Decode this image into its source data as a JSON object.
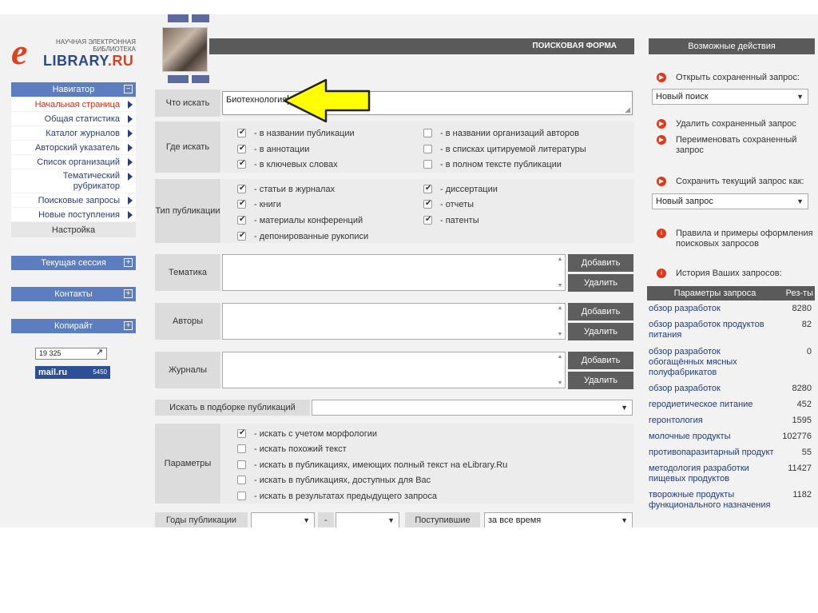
{
  "logo": {
    "line1": "НАУЧНАЯ ЭЛЕКТРОННАЯ",
    "line2": "БИБЛИОТЕКА",
    "letter": "e",
    "name_a": "LIBRARY",
    "name_b": ".RU"
  },
  "nav": {
    "header": "Навигатор",
    "items": [
      {
        "label": "Начальная страница",
        "active": true
      },
      {
        "label": "Общая статистика"
      },
      {
        "label": "Каталог журналов"
      },
      {
        "label": "Авторский указатель"
      },
      {
        "label": "Список организаций"
      },
      {
        "label": "Тематический рубрикатор"
      },
      {
        "label": "Поисковые запросы"
      },
      {
        "label": "Новые поступления"
      }
    ],
    "settings": "Настройка",
    "session": "Текущая сессия",
    "contacts": "Контакты",
    "copyright": "Копирайт"
  },
  "counters": {
    "liveinternet": "19 325",
    "mailru": "mail.ru",
    "mailru_num": "5450"
  },
  "form": {
    "title": "ПОИСКОВАЯ ФОРМА",
    "what_label": "Что искать",
    "query": "Биотехнология",
    "where_label": "Где искать",
    "where": [
      {
        "label": "- в названии публикации",
        "checked": true
      },
      {
        "label": "- в аннотации",
        "checked": true
      },
      {
        "label": "- в ключевых словах",
        "checked": true
      },
      {
        "label": "- в названии организаций авторов",
        "checked": false
      },
      {
        "label": "- в списках цитируемой литературы",
        "checked": false
      },
      {
        "label": "- в полном тексте публикации",
        "checked": false
      }
    ],
    "type_label": "Тип публикации",
    "types": [
      {
        "label": "- статьи в журналах",
        "checked": true
      },
      {
        "label": "- книги",
        "checked": true
      },
      {
        "label": "- материалы конференций",
        "checked": true
      },
      {
        "label": "- депонированные рукописи",
        "checked": true
      },
      {
        "label": "- диссертации",
        "checked": true
      },
      {
        "label": "- отчеты",
        "checked": true
      },
      {
        "label": "- патенты",
        "checked": true
      }
    ],
    "topic_label": "Тематика",
    "authors_label": "Авторы",
    "journals_label": "Журналы",
    "add": "Добавить",
    "remove": "Удалить",
    "collection_label": "Искать в подборке публикаций",
    "params_label": "Параметры",
    "params": [
      {
        "label": "- искать с учетом морфологии",
        "checked": true
      },
      {
        "label": "- искать похожий текст",
        "checked": false
      },
      {
        "label": "- искать в публикациях, имеющих полный текст на eLibrary.Ru",
        "checked": false
      },
      {
        "label": "- искать в публикациях, доступных для Вас",
        "checked": false
      },
      {
        "label": "- искать в результатах предыдущего запроса",
        "checked": false
      }
    ],
    "years_label": "Годы публикации",
    "dash": "-",
    "received_label": "Поступившие",
    "received_value": "за все время"
  },
  "actions": {
    "title": "Возможные действия",
    "open_saved": "Открыть сохраненный запрос:",
    "open_value": "Новый поиск",
    "delete_saved": "Удалить сохраненный запрос",
    "rename_saved": "Переименовать сохраненный запрос",
    "save_as": "Сохранить текущий запрос как:",
    "save_value": "Новый запрос",
    "rules": "Правила и примеры оформления поисковых запросов",
    "history": "История Ваших запросов:",
    "col_params": "Параметры запроса",
    "col_results": "Рез-ты",
    "history_rows": [
      {
        "q": "обзор разработок",
        "n": "8280"
      },
      {
        "q": "обзор разработок продуктов питания",
        "n": "82"
      },
      {
        "q": "обзор разработок обогащённых мясных полуфабрикатов",
        "n": "0"
      },
      {
        "q": "обзор разработок",
        "n": "8280"
      },
      {
        "q": "геродиетическое питание",
        "n": "452"
      },
      {
        "q": "геронтология",
        "n": "1595"
      },
      {
        "q": "молочные продукты",
        "n": "102776"
      },
      {
        "q": "противопаразитарный продукт",
        "n": "55"
      },
      {
        "q": "методология разработки пищевых продуктов",
        "n": "11427"
      },
      {
        "q": "творожные продукты функционального назначения",
        "n": "1182"
      }
    ]
  }
}
